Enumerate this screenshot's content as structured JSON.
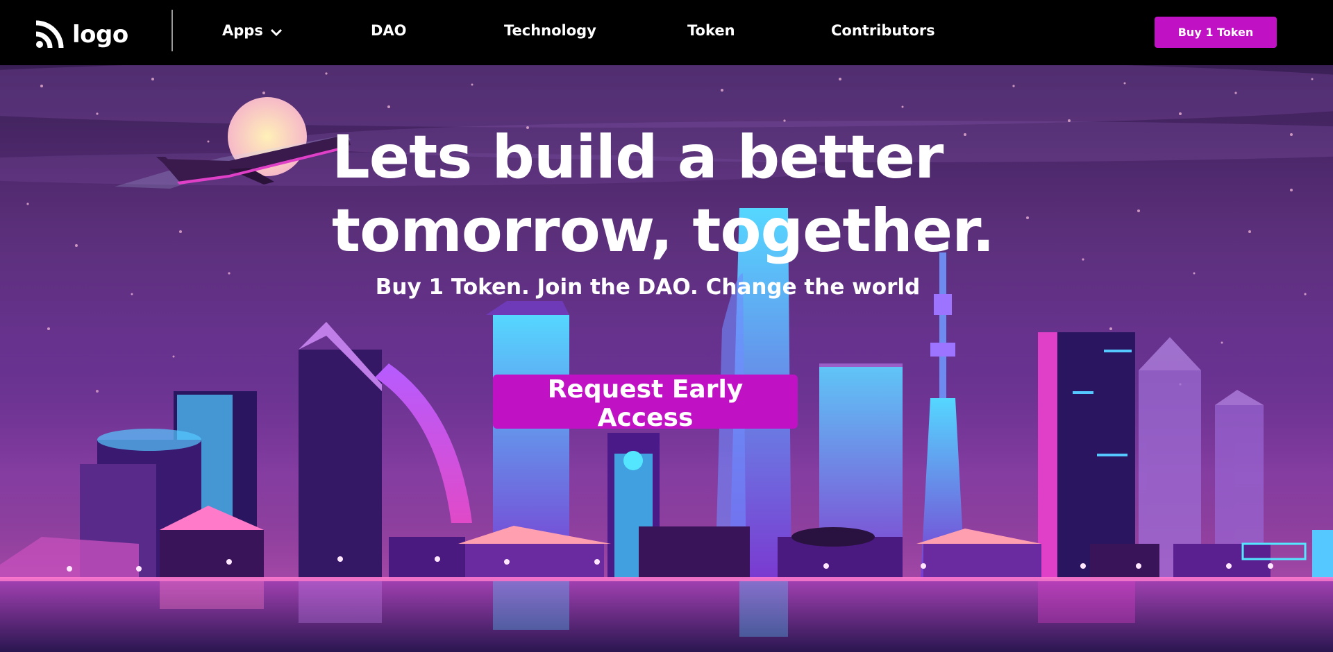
{
  "nav": {
    "logo_text": "logo",
    "items": [
      {
        "label": "Apps",
        "has_dropdown": true
      },
      {
        "label": "DAO"
      },
      {
        "label": "Technology"
      },
      {
        "label": "Token"
      },
      {
        "label": "Contributors"
      }
    ],
    "buy_button": "Buy 1 Token"
  },
  "hero": {
    "headline_line1": "Lets build a better",
    "headline_line2": "tomorrow, together.",
    "subheadline": "Buy 1 Token. Join the DAO. Change the world",
    "cta_button": "Request Early Access"
  },
  "colors": {
    "accent": "#c111c4",
    "nav_bg": "#000000",
    "sky_top": "#3a1f56",
    "sky_mid": "#6a3393"
  }
}
